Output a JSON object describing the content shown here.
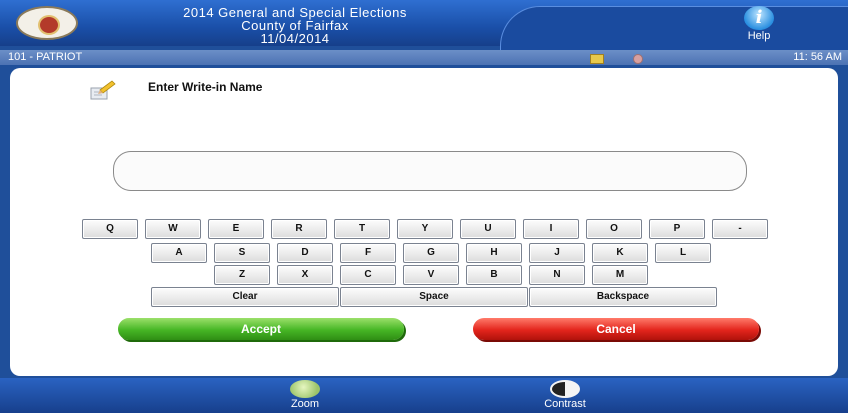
{
  "header": {
    "title_line1": "2014 General and Special Elections",
    "title_line2": "County of Fairfax",
    "title_line3": "11/04/2014",
    "help_label": "Help"
  },
  "status": {
    "precinct": "101 - PATRIOT",
    "time": "11: 56 AM"
  },
  "writein": {
    "title": "Enter Write-in Name",
    "value": ""
  },
  "keyboard": {
    "row1": [
      "Q",
      "W",
      "E",
      "R",
      "T",
      "Y",
      "U",
      "I",
      "O",
      "P",
      "-"
    ],
    "row2": [
      "A",
      "S",
      "D",
      "F",
      "G",
      "H",
      "J",
      "K",
      "L"
    ],
    "row3": [
      "Z",
      "X",
      "C",
      "V",
      "B",
      "N",
      "M"
    ],
    "clear": "Clear",
    "space": "Space",
    "backspace": "Backspace"
  },
  "actions": {
    "accept": "Accept",
    "cancel": "Cancel"
  },
  "footer": {
    "zoom": "Zoom",
    "contrast": "Contrast"
  }
}
